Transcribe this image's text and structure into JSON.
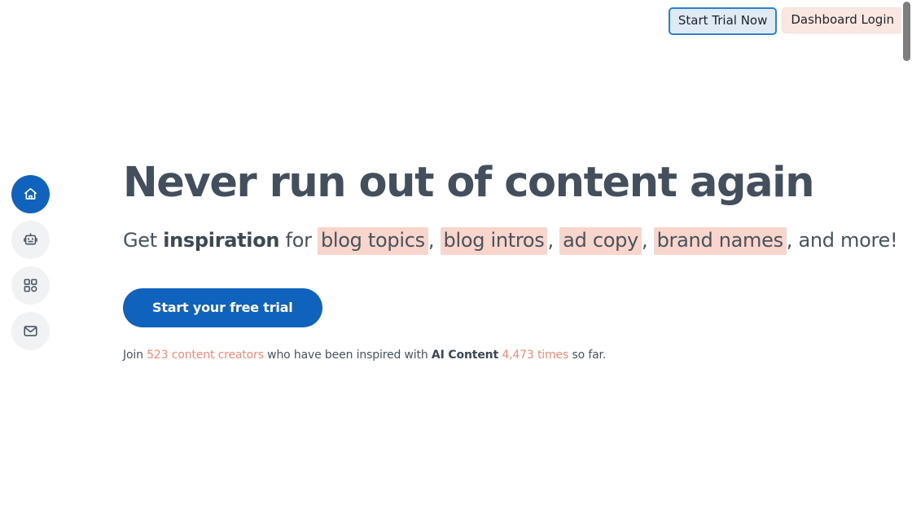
{
  "top_actions": {
    "start_trial_label": "Start Trial Now",
    "dashboard_login_label": "Dashboard Login",
    "trial_border_color": "#2f7fd0",
    "trial_bg_color": "#dfeaf5",
    "login_bg_color": "#fbe7e2"
  },
  "sidebar": {
    "items": [
      {
        "name": "home",
        "icon": "home-icon",
        "active": true
      },
      {
        "name": "bot",
        "icon": "robot-icon",
        "active": false
      },
      {
        "name": "apps",
        "icon": "grid-apps-icon",
        "active": false
      },
      {
        "name": "mail",
        "icon": "envelope-icon",
        "active": false
      }
    ],
    "active_color": "#0f63bd",
    "inactive_color": "#f0f2f4"
  },
  "hero": {
    "headline": "Never run out of content again",
    "subhead": {
      "lead_plain": "Get ",
      "lead_bold": "inspiration",
      "lead_after": " for ",
      "highlights": [
        "blog topics",
        "blog intros",
        "ad copy",
        "brand names"
      ],
      "separator": ", ",
      "tail": ", and more!",
      "highlight_color": "#fad5cc"
    },
    "cta_label": "Start your free trial",
    "cta_color": "#0f63bd",
    "social_proof": {
      "prefix": "Join ",
      "creators_count": "523 content creators",
      "middle": " who have been inspired with ",
      "product": "AI Content",
      "times": "4,473 times",
      "suffix": " so far.",
      "accent_color": "#f88a73"
    }
  },
  "scrollbar": {
    "thumb_color": "#7e7e7e"
  }
}
